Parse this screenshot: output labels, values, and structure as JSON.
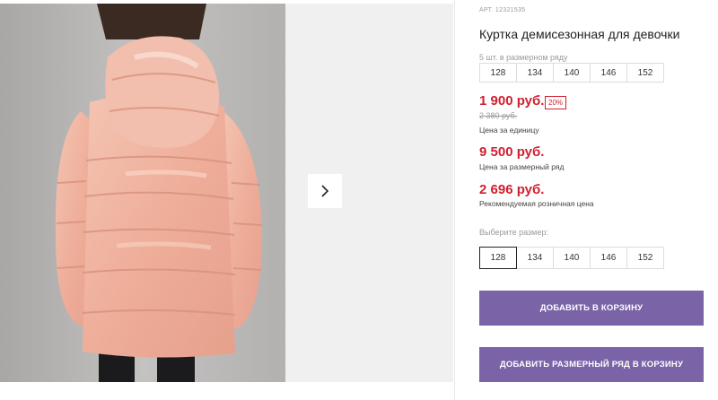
{
  "product": {
    "article": "АРТ. 12321535",
    "title": "Куртка демисезонная для девочки"
  },
  "pack": {
    "label": "5 шт. в размерном ряду",
    "sizes": [
      "128",
      "134",
      "140",
      "146",
      "152"
    ]
  },
  "prices": {
    "unit_price": "1 900 руб.",
    "discount": "20%",
    "old_price": "2 380 руб.",
    "unit_label": "Цена за единицу",
    "pack_price": "9 500 руб.",
    "pack_label": "Цена за размерный ряд",
    "retail_price": "2 696 руб.",
    "retail_label": "Рекомендуемая розничная цена"
  },
  "size_select": {
    "label": "Выберите размер:",
    "options": [
      "128",
      "134",
      "140",
      "146",
      "152"
    ],
    "selected": "128"
  },
  "actions": {
    "add_to_cart": "ДОБАВИТЬ В КОРЗИНУ",
    "add_pack_to_cart": "ДОБАВИТЬ РАЗМЕРНЫЙ РЯД В КОРЗИНУ"
  },
  "colors": {
    "price_red": "#d0202f",
    "button_purple": "#7a63a7",
    "jacket_pink": "#f0b7a4"
  },
  "icons": {
    "next": "chevron-right-icon"
  }
}
